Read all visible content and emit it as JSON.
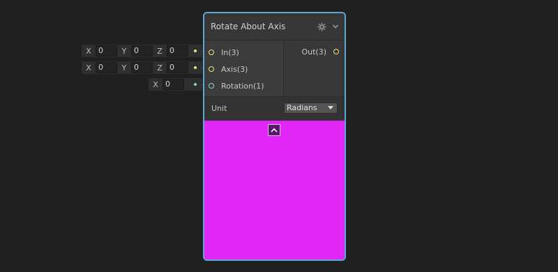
{
  "node": {
    "title": "Rotate About Axis",
    "inputs": [
      {
        "label": "In(3)",
        "kind": "vector3"
      },
      {
        "label": "Axis(3)",
        "kind": "vector3"
      },
      {
        "label": "Rotation(1)",
        "kind": "vector1"
      }
    ],
    "outputs": [
      {
        "label": "Out(3)"
      }
    ],
    "unit": {
      "label": "Unit",
      "selected": "Radians"
    },
    "preview_color": "#e027f8",
    "accent_border": "#5ea8d8"
  },
  "defaults": {
    "in": {
      "x_label": "X",
      "x": "0",
      "y_label": "Y",
      "y": "0",
      "z_label": "Z",
      "z": "0"
    },
    "axis": {
      "x_label": "X",
      "x": "0",
      "y_label": "Y",
      "y": "0",
      "z_label": "Z",
      "z": "0"
    },
    "rotation": {
      "x_label": "X",
      "x": "0"
    }
  },
  "colors": {
    "vector3_port": "#e8e880",
    "vector1_port": "#8fd0d6",
    "background": "#202020"
  },
  "icons": {
    "settings": "gear-icon",
    "collapse_node": "chevron-down-icon",
    "collapse_preview": "chevron-up-icon"
  }
}
